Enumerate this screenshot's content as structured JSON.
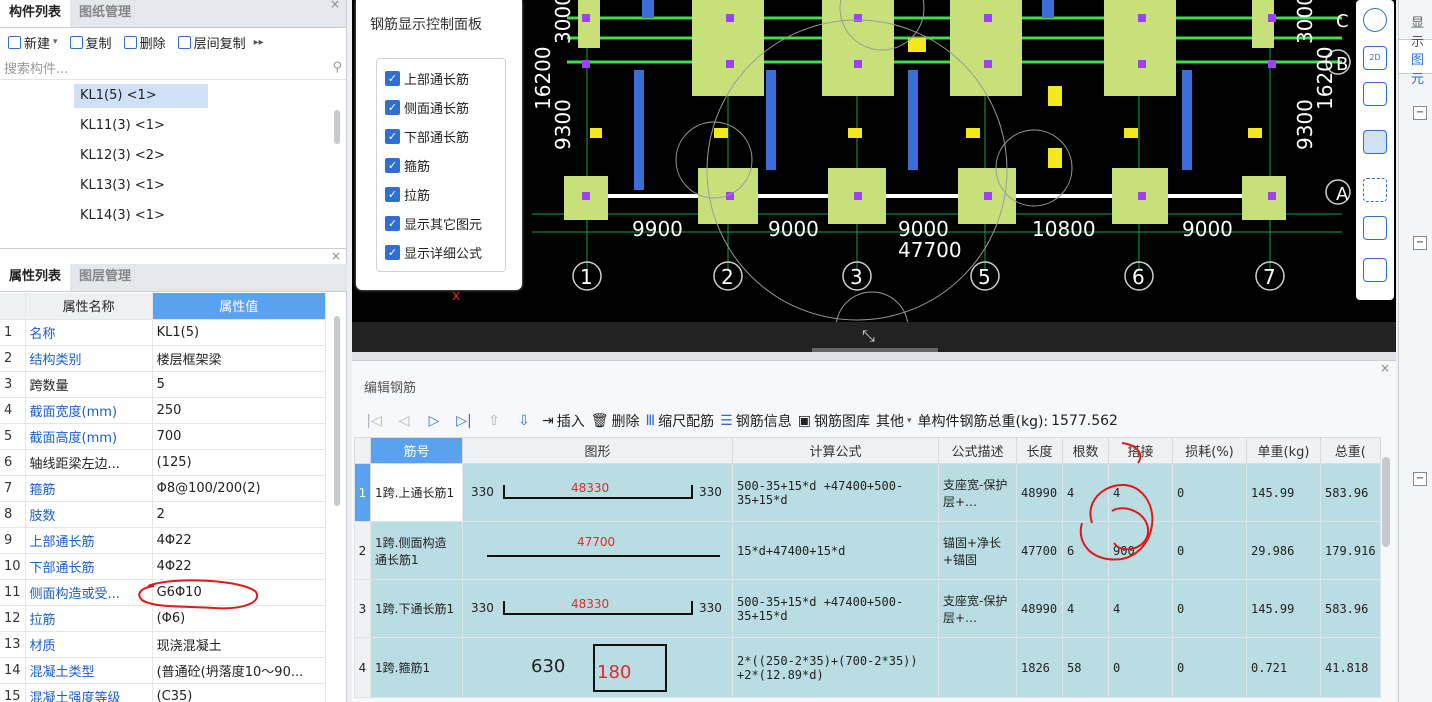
{
  "left_panel": {
    "tabs": [
      "构件列表",
      "图纸管理"
    ],
    "toolbar": {
      "new_label": "新建",
      "copy_label": "复制",
      "delete_label": "删除",
      "floor_copy_label": "层间复制"
    },
    "search_placeholder": "搜索构件...",
    "components": [
      "KL1(5) <1>",
      "KL11(3) <1>",
      "KL12(3) <2>",
      "KL13(3) <1>",
      "KL14(3) <1>"
    ],
    "selected_component": "KL1(5) <1>"
  },
  "props_panel": {
    "tabs": [
      "属性列表",
      "图层管理"
    ],
    "headers": {
      "name": "属性名称",
      "value": "属性值"
    },
    "rows": [
      {
        "n": "1",
        "name": "名称",
        "value": "KL1(5)",
        "blue": true
      },
      {
        "n": "2",
        "name": "结构类别",
        "value": "楼层框架梁",
        "blue": true
      },
      {
        "n": "3",
        "name": "跨数量",
        "value": "5",
        "blue": false
      },
      {
        "n": "4",
        "name": "截面宽度(mm)",
        "value": "250",
        "blue": true
      },
      {
        "n": "5",
        "name": "截面高度(mm)",
        "value": "700",
        "blue": true
      },
      {
        "n": "6",
        "name": "轴线距梁左边...",
        "value": "(125)",
        "blue": false
      },
      {
        "n": "7",
        "name": "箍筋",
        "value": "Φ8@100/200(2)",
        "blue": true
      },
      {
        "n": "8",
        "name": "肢数",
        "value": "2",
        "blue": true
      },
      {
        "n": "9",
        "name": "上部通长筋",
        "value": "4Φ22",
        "blue": true
      },
      {
        "n": "10",
        "name": "下部通长筋",
        "value": "4Φ22",
        "blue": true
      },
      {
        "n": "11",
        "name": "侧面构造或受...",
        "value": "G6Φ10",
        "blue": true
      },
      {
        "n": "12",
        "name": "拉筋",
        "value": "(Φ6)",
        "blue": true
      },
      {
        "n": "13",
        "name": "材质",
        "value": "现浇混凝土",
        "blue": true
      },
      {
        "n": "14",
        "name": "混凝土类型",
        "value": "(普通砼(坍落度10～90...",
        "blue": true
      },
      {
        "n": "15",
        "name": "混凝土强度等级",
        "value": "(C35)",
        "blue": true
      }
    ]
  },
  "control_panel": {
    "title": "钢筋显示控制面板",
    "options": [
      "上部通长筋",
      "侧面通长筋",
      "下部通长筋",
      "箍筋",
      "拉筋",
      "显示其它图元",
      "显示详细公式"
    ]
  },
  "cad": {
    "dims_bottom": [
      "9900",
      "9000",
      "9000",
      "10800",
      "9000"
    ],
    "total": "47700",
    "axes": [
      "1",
      "2",
      "3",
      "5",
      "6",
      "7"
    ],
    "left_dims": [
      "16200",
      "9300",
      "3000"
    ],
    "right_dims": [
      "16200",
      "9300",
      "3000"
    ],
    "row_labels": [
      "C",
      "B",
      "A"
    ]
  },
  "right_strip": {
    "title": "显示",
    "tab": "图元"
  },
  "editor": {
    "title": "编辑钢筋",
    "toolbar": {
      "insert": "插入",
      "delete": "删除",
      "scale": "缩尺配筋",
      "info": "钢筋信息",
      "library": "钢筋图库",
      "other": "其他",
      "weight_label": "单构件钢筋总重(kg):",
      "weight_value": "1577.562"
    },
    "headers": [
      "筋号",
      "图形",
      "计算公式",
      "公式描述",
      "长度",
      "根数",
      "搭接",
      "损耗(%)",
      "单重(kg)",
      "总重("
    ],
    "rows": [
      {
        "idx": "1",
        "name": "1跨.上通长筋1",
        "shape_left": "330",
        "shape_mid": "48330",
        "shape_right": "330",
        "formula": "500-35+15*d +47400+500-35+15*d",
        "desc": "支座宽-保护层+…",
        "length": "48990",
        "count": "4",
        "lap": "4",
        "loss": "0",
        "unit": "145.99",
        "total": "583.96"
      },
      {
        "idx": "2",
        "name": "1跨.侧面构造通长筋1",
        "shape_left": "",
        "shape_mid": "47700",
        "shape_right": "",
        "formula": "15*d+47400+15*d",
        "desc": "锚固+净长+锚固",
        "length": "47700",
        "count": "6",
        "lap": "900",
        "loss": "0",
        "unit": "29.986",
        "total": "179.916"
      },
      {
        "idx": "3",
        "name": "1跨.下通长筋1",
        "shape_left": "330",
        "shape_mid": "48330",
        "shape_right": "330",
        "formula": "500-35+15*d +47400+500-35+15*d",
        "desc": "支座宽-保护层+…",
        "length": "48990",
        "count": "4",
        "lap": "4",
        "loss": "0",
        "unit": "145.99",
        "total": "583.96"
      },
      {
        "idx": "4",
        "name": "1跨.箍筋1",
        "shape_left": "630",
        "shape_mid": "180",
        "shape_right": "",
        "formula": "2*((250-2*35)+(700-2*35)) +2*(12.89*d)",
        "desc": "",
        "length": "1826",
        "count": "58",
        "lap": "0",
        "loss": "0",
        "unit": "0.721",
        "total": "41.818"
      }
    ]
  }
}
